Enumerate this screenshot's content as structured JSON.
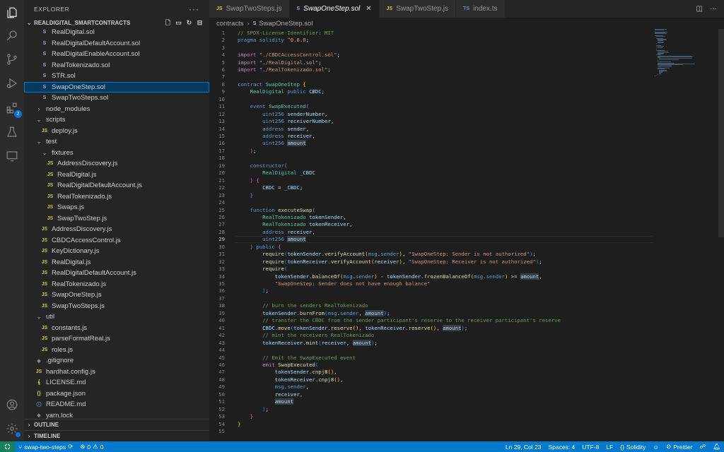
{
  "sidebar": {
    "title": "EXPLORER",
    "more": "···",
    "project": "REALDIGITAL_SMARTCONTRACTS",
    "items": [
      {
        "label": "RealDigital.sol",
        "type": "sol",
        "indent": 1
      },
      {
        "label": "RealDigitalDefaultAccount.sol",
        "type": "sol",
        "indent": 1
      },
      {
        "label": "RealDigitalEnableAccount.sol",
        "type": "sol",
        "indent": 1
      },
      {
        "label": "RealTokenizado.sol",
        "type": "sol",
        "indent": 1
      },
      {
        "label": "STR.sol",
        "type": "sol",
        "indent": 1
      },
      {
        "label": "SwapOneStep.sol",
        "type": "sol",
        "indent": 1,
        "selected": true
      },
      {
        "label": "SwapTwoSteps.sol",
        "type": "sol",
        "indent": 1
      },
      {
        "label": "node_modules",
        "type": "folder-closed",
        "indent": 0
      },
      {
        "label": "scripts",
        "type": "folder-open",
        "indent": 0
      },
      {
        "label": "deploy.js",
        "type": "js",
        "indent": 1
      },
      {
        "label": "test",
        "type": "folder-open",
        "indent": 0
      },
      {
        "label": "fixtures",
        "type": "folder-open",
        "indent": 1
      },
      {
        "label": "AddressDiscovery.js",
        "type": "js",
        "indent": 2
      },
      {
        "label": "RealDigital.js",
        "type": "js",
        "indent": 2
      },
      {
        "label": "RealDigitalDefaultAccount.js",
        "type": "js",
        "indent": 2
      },
      {
        "label": "RealTokenizado.js",
        "type": "js",
        "indent": 2
      },
      {
        "label": "Swaps.js",
        "type": "js",
        "indent": 2
      },
      {
        "label": "SwapTwoStep.js",
        "type": "js",
        "indent": 2
      },
      {
        "label": "AddressDiscovery.js",
        "type": "js",
        "indent": 1
      },
      {
        "label": "CBDCAccessControl.js",
        "type": "js",
        "indent": 1
      },
      {
        "label": "KeyDictionary.js",
        "type": "js",
        "indent": 1
      },
      {
        "label": "RealDigital.js",
        "type": "js",
        "indent": 1
      },
      {
        "label": "RealDigitalDefaultAccount.js",
        "type": "js",
        "indent": 1
      },
      {
        "label": "RealTokenizado.js",
        "type": "js",
        "indent": 1
      },
      {
        "label": "SwapOneStep.js",
        "type": "js",
        "indent": 1
      },
      {
        "label": "SwapTwoSteps.js",
        "type": "js",
        "indent": 1
      },
      {
        "label": "util",
        "type": "folder-open",
        "indent": 0
      },
      {
        "label": "constants.js",
        "type": "js",
        "indent": 1
      },
      {
        "label": "parseFormatReal.js",
        "type": "js",
        "indent": 1
      },
      {
        "label": "roles.js",
        "type": "js",
        "indent": 1
      },
      {
        "label": ".gitignore",
        "type": "git",
        "indent": 0
      },
      {
        "label": "hardhat.config.js",
        "type": "js",
        "indent": 0
      },
      {
        "label": "LICENSE.md",
        "type": "lic",
        "indent": 0
      },
      {
        "label": "package.json",
        "type": "json",
        "indent": 0
      },
      {
        "label": "README.md",
        "type": "info",
        "indent": 0
      },
      {
        "label": "yarn.lock",
        "type": "git",
        "indent": 0
      }
    ],
    "outline": "OUTLINE",
    "timeline": "TIMELINE"
  },
  "tabs": [
    {
      "label": "SwapTwoSteps.js",
      "icon": "JS",
      "active": false
    },
    {
      "label": "SwapOneStep.sol",
      "icon": "S",
      "active": true
    },
    {
      "label": "SwapTwoStep.js",
      "icon": "JS",
      "active": false
    },
    {
      "label": "index.ts",
      "icon": "TS",
      "active": false
    }
  ],
  "breadcrumb": {
    "folder": "contracts",
    "file": "SwapOneStep.sol"
  },
  "code": {
    "current_line": 29,
    "lines": [
      "<span class=\"c\">// SPDX-License-Identifier: MIT</span>",
      "<span class=\"k\">pragma</span> <span class=\"k\">solidity</span> <span class=\"s\">^0.8.0</span>;",
      "",
      "<span class=\"p\">import</span> <span class=\"s\">\"./CBDCAccessControl.sol\"</span>;",
      "<span class=\"p\">import</span> <span class=\"s\">\"./RealDigital.sol\"</span>;",
      "<span class=\"p\">import</span> <span class=\"s\">\"./RealTokenizado.sol\"</span>;",
      "",
      "<span class=\"k\">contract</span> <span class=\"t\">SwapOneStep</span> <span class=\"y\">{</span>",
      "    <span class=\"t\">RealDigital</span> <span class=\"k\">public</span> <span class=\"v\">CBDC</span>;",
      "",
      "    <span class=\"k\">event</span> <span class=\"t\">SwapExecuted</span><span class=\"pk\">(</span>",
      "        <span class=\"k\">uint256</span> <span class=\"v\">senderNumber</span>,",
      "        <span class=\"k\">uint256</span> <span class=\"v\">receiverNumber</span>,",
      "        <span class=\"k\">address</span> <span class=\"v\">sender</span>,",
      "        <span class=\"k\">address</span> <span class=\"v\">receiver</span>,",
      "        <span class=\"k\">uint256</span> <span class=\"v hl\">amount</span>",
      "    <span class=\"pk\">)</span>;",
      "",
      "    <span class=\"k\">constructor</span><span class=\"pk\">(</span>",
      "        <span class=\"t\">RealDigital</span> <span class=\"v\">_CBDC</span>",
      "    <span class=\"pk\">)</span> <span class=\"pk\">{</span>",
      "        <span class=\"v\">CBDC</span> = <span class=\"v\">_CBDC</span>;",
      "    <span class=\"pk\">}</span>",
      "",
      "    <span class=\"k\">function</span> <span class=\"f\">executeSwap</span><span class=\"pk\">(</span>",
      "        <span class=\"t\">RealTokenizado</span> <span class=\"v\">tokenSender</span>,",
      "        <span class=\"t\">RealTokenizado</span> <span class=\"v\">tokenReceiver</span>,",
      "        <span class=\"k\">address</span> <span class=\"v\">receiver</span>,",
      "        <span class=\"k\">uint256</span> <span class=\"v hl\">amount</span>",
      "    <span class=\"pk\">)</span> <span class=\"k\">public</span> <span class=\"pk\">{</span>",
      "        <span class=\"f\">require</span><span class=\"b\">(</span><span class=\"v\">tokenSender</span>.<span class=\"f\">verifyAccount</span><span class=\"y\">(</span><span class=\"k\">msg</span>.<span class=\"k\">sender</span><span class=\"y\">)</span>, <span class=\"s\">\"SwapOneStep: Sender is not authorized\"</span><span class=\"b\">)</span>;",
      "        <span class=\"f\">require</span><span class=\"b\">(</span><span class=\"v\">tokenReceiver</span>.<span class=\"f\">verifyAccount</span><span class=\"y\">(</span><span class=\"v\">receiver</span><span class=\"y\">)</span>, <span class=\"s\">\"SwapOneStep: Receiver is not authorized\"</span><span class=\"b\">)</span>;",
      "        <span class=\"f\">require</span><span class=\"b\">(</span>",
      "            <span class=\"v\">tokenSender</span>.<span class=\"f\">balanceOf</span><span class=\"y\">(</span><span class=\"k\">msg</span>.<span class=\"k\">sender</span><span class=\"y\">)</span> - <span class=\"v\">tokenSender</span>.<span class=\"f\">frozenBalanceOf</span><span class=\"y\">(</span><span class=\"k\">msg</span>.<span class=\"k\">sender</span><span class=\"y\">)</span> >= <span class=\"v hl\">amount</span>,",
      "            <span class=\"s\">\"SwapOneStep: Sender does not have enough balance\"</span>",
      "        <span class=\"b\">)</span>;",
      "",
      "        <span class=\"c\">// burn the senders RealTokenizado</span>",
      "        <span class=\"v\">tokenSender</span>.<span class=\"f\">burnFrom</span><span class=\"b\">(</span><span class=\"k\">msg</span>.<span class=\"k\">sender</span>, <span class=\"v hl\">amount</span><span class=\"b\">)</span>;",
      "        <span class=\"c\">// transfer the CBDC from the sender participant's reserve to the receiver participant's reserve</span>",
      "        <span class=\"v\">CBDC</span>.<span class=\"f\">move</span><span class=\"b\">(</span><span class=\"v\">tokenSender</span>.<span class=\"f\">reserve</span><span class=\"y\">()</span>, <span class=\"v\">tokenReceiver</span>.<span class=\"f\">reserve</span><span class=\"y\">()</span>, <span class=\"v hl\">amount</span><span class=\"b\">)</span>;",
      "        <span class=\"c\">// mint the receivers RealTokenizado</span>",
      "        <span class=\"v\">tokenReceiver</span>.<span class=\"f\">mint</span><span class=\"b\">(</span><span class=\"v\">receiver</span>, <span class=\"v hl\">amount</span><span class=\"b\">)</span>;",
      "",
      "        <span class=\"c\">// Emit the SwapExecuted event</span>",
      "        <span class=\"p\">emit</span> <span class=\"f\">SwapExecuted</span><span class=\"b\">(</span>",
      "            <span class=\"v\">tokenSender</span>.<span class=\"f\">cnpj8</span><span class=\"y\">()</span>,",
      "            <span class=\"v\">tokenReceiver</span>.<span class=\"f\">cnpj8</span><span class=\"y\">()</span>,",
      "            <span class=\"k\">msg</span>.<span class=\"k\">sender</span>,",
      "            <span class=\"v\">receiver</span>,",
      "            <span class=\"v hl\">amount</span>",
      "        <span class=\"b\">)</span>;",
      "    <span class=\"pk\">}</span>",
      "<span class=\"y\">}</span>",
      ""
    ]
  },
  "status": {
    "branch": "swap-two-steps",
    "errors": "0",
    "warnings": "0",
    "cursor": "Ln 29, Col 23",
    "spaces": "Spaces: 4",
    "encoding": "UTF-8",
    "eol": "LF",
    "language": "Solidity",
    "formatter": "Prettier"
  },
  "activity_badge": "2"
}
